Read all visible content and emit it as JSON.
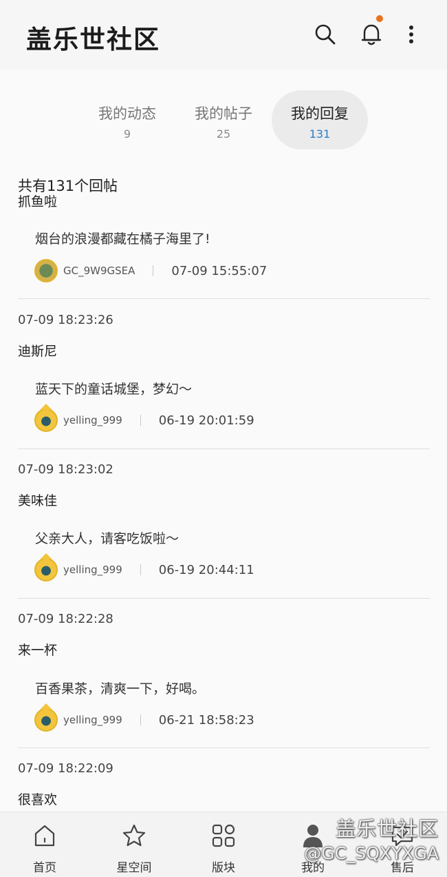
{
  "header": {
    "title": "盖乐世社区",
    "icons": [
      "search-icon",
      "bell-icon",
      "more-vertical-icon"
    ],
    "notification_dot_color": "#e8731f"
  },
  "tabs": [
    {
      "label": "我的动态",
      "count": "9",
      "active": false
    },
    {
      "label": "我的帖子",
      "count": "25",
      "active": false
    },
    {
      "label": "我的回复",
      "count": "131",
      "active": true
    }
  ],
  "accent_color": "#2a7ec6",
  "total_label": "共有131个回帖",
  "replies": [
    {
      "time": "",
      "title": "抓鱼啦",
      "quote": "烟台的浪漫都藏在橘子海里了!",
      "user": "GC_9W9GSEA",
      "post_time": "07-09 15:55:07"
    },
    {
      "time": "07-09 18:23:26",
      "title": "迪斯尼",
      "quote": "蓝天下的童话城堡，梦幻～",
      "user": "yelling_999",
      "post_time": "06-19 20:01:59"
    },
    {
      "time": "07-09 18:23:02",
      "title": "美味佳",
      "quote": "父亲大人，请客吃饭啦～",
      "user": "yelling_999",
      "post_time": "06-19 20:44:11"
    },
    {
      "time": "07-09 18:22:28",
      "title": "来一杯",
      "quote": "百香果茶，清爽一下，好喝。",
      "user": "yelling_999",
      "post_time": "06-21 18:58:23"
    },
    {
      "time": "07-09 18:22:09",
      "title": "很喜欢",
      "quote": "",
      "user": "",
      "post_time": ""
    }
  ],
  "bottom_nav": [
    {
      "label": "首页",
      "icon": "home-icon"
    },
    {
      "label": "星空间",
      "icon": "star-icon"
    },
    {
      "label": "版块",
      "icon": "grid-icon"
    },
    {
      "label": "我的",
      "icon": "person-icon"
    },
    {
      "label": "售后",
      "icon": "service-icon"
    }
  ],
  "watermark": {
    "line1": "盖乐世社区",
    "line2": "@GC_SQXYXGA"
  }
}
